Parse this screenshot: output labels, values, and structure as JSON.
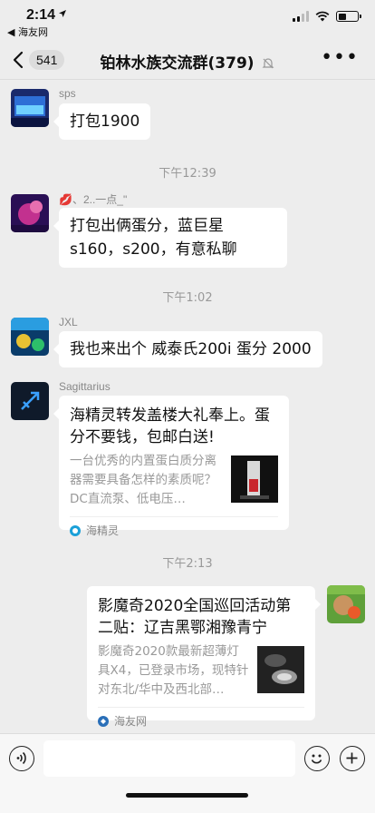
{
  "status": {
    "time": "2:14",
    "back_app": "◀ 海友网"
  },
  "nav": {
    "unread_count": "541",
    "title": "铂林水族交流群(379)"
  },
  "messages": [
    {
      "sender": "sps",
      "text": "打包1900"
    },
    {
      "divider": "下午12:39"
    },
    {
      "sender": "💋、2..一点_\"",
      "text": "打包出俩蛋分，蓝巨星s160，s200，有意私聊"
    },
    {
      "divider": "下午1:02"
    },
    {
      "sender": "JXL",
      "text": "我也来出个 威泰氏200i 蛋分 2000"
    },
    {
      "sender": "Sagittarius",
      "card": {
        "title": "海精灵转发盖楼大礼奉上。蛋分不要钱，包邮白送!",
        "desc": "一台优秀的内置蛋白质分离器需要具备怎样的素质呢？DC直流泵、低电压…",
        "source": "海精灵"
      }
    },
    {
      "divider": "下午2:13"
    },
    {
      "self": true,
      "card": {
        "title": "影魔奇2020全国巡回活动第二贴：辽吉黑鄂湘豫青宁",
        "desc": "影魔奇2020款最新超薄灯具X4，已登录市场，现特针对东北/华中及西北部…",
        "source": "海友网"
      }
    }
  ],
  "colors": {
    "bg": "#ededed",
    "bubble": "#ffffff",
    "accent_green": "#07c160"
  },
  "icons": [
    "back-chevron-icon",
    "mute-bell-icon",
    "more-dots-icon",
    "voice-icon",
    "emoji-icon",
    "plus-icon",
    "wifi-icon",
    "signal-icon",
    "battery-icon"
  ]
}
